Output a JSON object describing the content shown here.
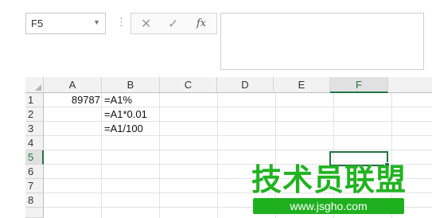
{
  "formula_bar": {
    "name_box": "F5",
    "cancel_glyph": "✕",
    "enter_glyph": "✓",
    "fx_label": "fx",
    "separator": "⋮",
    "formula": ""
  },
  "columns": [
    "A",
    "B",
    "C",
    "D",
    "E",
    "F"
  ],
  "selected_column": "F",
  "rows": [
    "1",
    "2",
    "3",
    "4",
    "5",
    "6",
    "7",
    "8"
  ],
  "selected_row": "5",
  "cells": {
    "A1": "89787",
    "B1": "=A1%",
    "B2": "=A1*0.01",
    "B3": "=A1/100"
  },
  "watermark": {
    "title": "技术员联盟",
    "url": "www.jsgho.com"
  },
  "colors": {
    "accent": "#217346",
    "watermark": "#21b321"
  }
}
